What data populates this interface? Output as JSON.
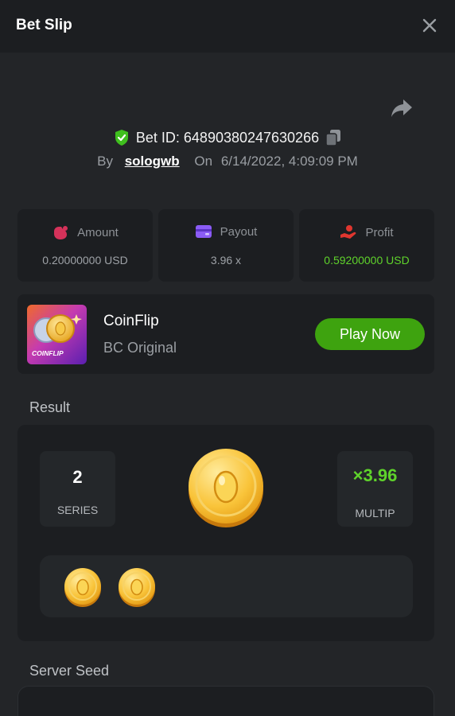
{
  "header": {
    "title": "Bet Slip"
  },
  "bet": {
    "id_text": "Bet ID: 64890380247630266",
    "by_label": "By",
    "username": "sologwb",
    "on_label": "On",
    "date": "6/14/2022, 4:09:09 PM"
  },
  "stats": [
    {
      "label": "Amount",
      "value": "0.20000000 USD",
      "icon": "money-bag-icon",
      "color": "#d5325a"
    },
    {
      "label": "Payout",
      "value": "3.96 x",
      "icon": "wallet-card-icon",
      "color": "#8b5cf6"
    },
    {
      "label": "Profit",
      "value": "0.59200000 USD",
      "icon": "hand-coin-icon",
      "color": "#e0362f"
    }
  ],
  "game": {
    "name": "CoinFlip",
    "subtitle": "BC Original",
    "thumb_text": "COINFLIP",
    "play_label": "Play Now"
  },
  "result": {
    "section_label": "Result",
    "series_value": "2",
    "series_label": "SERIES",
    "multiplier_value": "×3.96",
    "multiplier_label": "MULTIP",
    "history_coins": 2
  },
  "server_seed": {
    "label": "Server Seed"
  },
  "colors": {
    "accent_green": "#5fd32b",
    "button_green": "#3ea30f",
    "panel": "#1c1e21",
    "background": "#232528"
  }
}
